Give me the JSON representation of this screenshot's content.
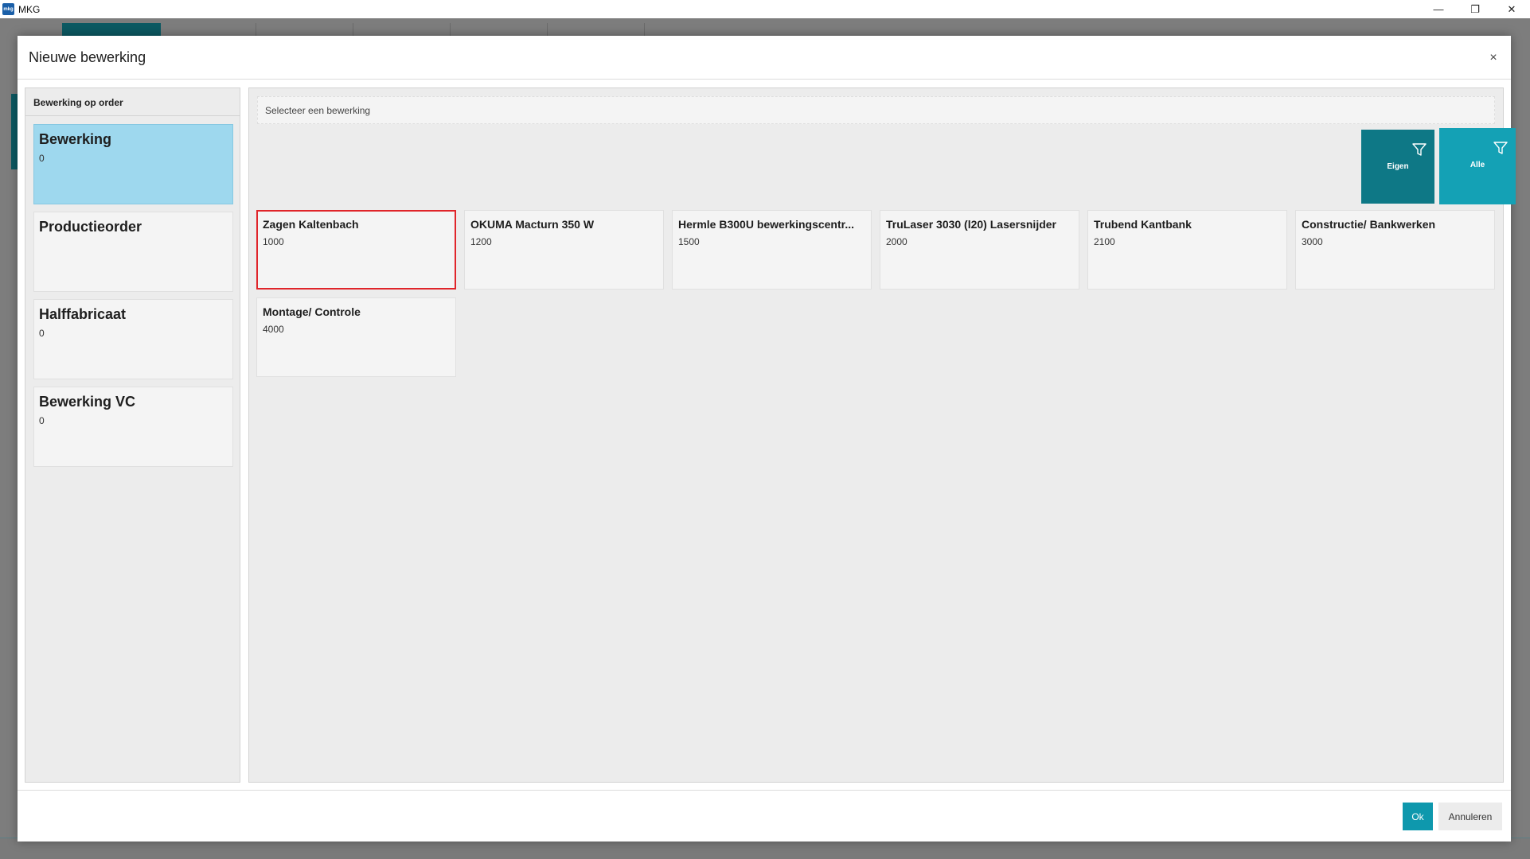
{
  "app": {
    "logo_text": "mkg",
    "title": "MKG",
    "controls": {
      "minimize": "—",
      "restore": "❐",
      "close": "✕"
    }
  },
  "dialog": {
    "title": "Nieuwe bewerking",
    "close_glyph": "×"
  },
  "left_panel": {
    "header": "Bewerking op order",
    "categories": [
      {
        "title": "Bewerking",
        "count": "0",
        "selected": true
      },
      {
        "title": "Productieorder",
        "count": ""
      },
      {
        "title": "Halffabricaat",
        "count": "0"
      },
      {
        "title": "Bewerking VC",
        "count": "0"
      }
    ]
  },
  "right_panel": {
    "search_label": "Selecteer een bewerking",
    "filters": {
      "own_label": "Eigen",
      "all_label": "Alle"
    },
    "operations": [
      {
        "title": "Zagen Kaltenbach",
        "code": "1000"
      },
      {
        "title": "OKUMA Macturn 350 W",
        "code": "1200"
      },
      {
        "title": "Hermle B300U bewerkingscentr...",
        "code": "1500"
      },
      {
        "title": "TruLaser 3030 (l20) Lasersnijder",
        "code": "2000"
      },
      {
        "title": "Trubend Kantbank",
        "code": "2100"
      },
      {
        "title": "Constructie/ Bankwerken",
        "code": "3000"
      },
      {
        "title": "Montage/ Controle",
        "code": "4000"
      }
    ]
  },
  "footer": {
    "ok_label": "Ok",
    "cancel_label": "Annuleren"
  },
  "colors": {
    "accent_dark": "#0e7886",
    "accent": "#14a1b5",
    "selected_category": "#9ed8ee",
    "highlight_border": "#e0252a"
  }
}
